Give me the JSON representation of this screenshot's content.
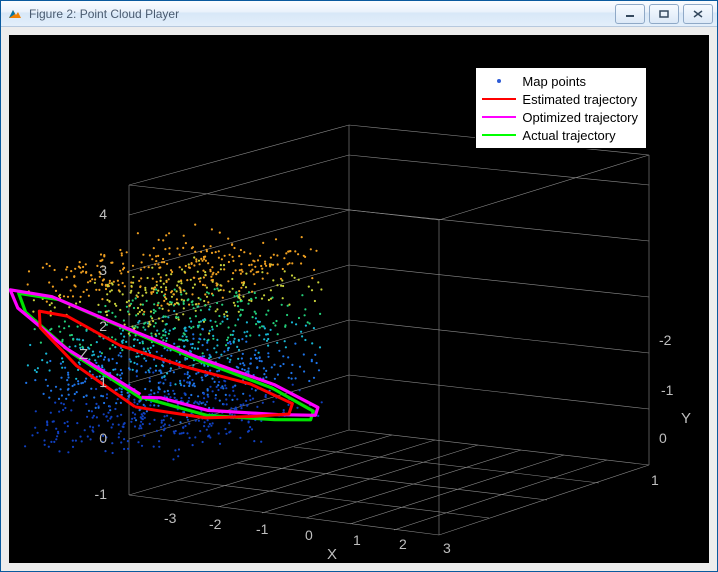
{
  "window": {
    "title": "Figure 2: Point Cloud Player",
    "controls": {
      "minimize": "minimize",
      "maximize": "maximize",
      "close": "close"
    }
  },
  "axes": {
    "xlabel": "X",
    "ylabel": "Y",
    "zlabel": "Z",
    "xticks": [
      "-3",
      "-2",
      "-1",
      "0",
      "1",
      "2",
      "3"
    ],
    "yticks": [
      "-2",
      "-1",
      "0",
      "1"
    ],
    "zticks": [
      "-1",
      "0",
      "1",
      "2",
      "3",
      "4"
    ]
  },
  "legend": {
    "items": [
      {
        "label": "Map points",
        "kind": "dot",
        "color": "#2d5bd6"
      },
      {
        "label": "Estimated trajectory",
        "kind": "line",
        "color": "#ff0000"
      },
      {
        "label": "Optimized trajectory",
        "kind": "line",
        "color": "#ff00ff"
      },
      {
        "label": "Actual trajectory",
        "kind": "line",
        "color": "#00ff00"
      }
    ]
  },
  "chart_data": {
    "type": "scatter",
    "title": "",
    "xlabel": "X",
    "ylabel": "Y",
    "zlabel": "Z",
    "xlim": [
      -3.5,
      3.5
    ],
    "ylim": [
      -2.5,
      1.5
    ],
    "zlim": [
      -1,
      4.5
    ],
    "map_points": {
      "description": "Dense 3D point cloud colored by height (z); exact coordinates not recoverable from raster. Roughly 2000+ points clustered in x∈[-2,2], y∈[-2,1], z∈[1,4], color ramp blue→cyan→green→yellow→orange with increasing z.",
      "approx_count": 2500
    },
    "series": [
      {
        "name": "Estimated trajectory",
        "color": "#ff0000",
        "xyz_approx": [
          [
            -1.5,
            0.0,
            1.2
          ],
          [
            -2.2,
            -0.5,
            2.0
          ],
          [
            -2.4,
            -1.0,
            2.8
          ],
          [
            -1.8,
            -1.5,
            3.3
          ],
          [
            -0.8,
            -1.8,
            3.4
          ],
          [
            0.4,
            -1.8,
            3.0
          ],
          [
            1.4,
            -1.4,
            2.6
          ],
          [
            2.1,
            -0.8,
            2.2
          ],
          [
            2.3,
            -0.2,
            1.7
          ],
          [
            1.6,
            0.3,
            1.3
          ],
          [
            0.6,
            0.5,
            1.1
          ],
          [
            -0.4,
            0.4,
            1.0
          ],
          [
            -1.2,
            0.2,
            1.1
          ]
        ]
      },
      {
        "name": "Optimized trajectory",
        "color": "#ff00ff",
        "xyz_approx": [
          [
            -1.6,
            0.2,
            1.3
          ],
          [
            -2.5,
            -0.4,
            2.2
          ],
          [
            -2.7,
            -1.1,
            3.1
          ],
          [
            -2.0,
            -1.8,
            3.7
          ],
          [
            -0.7,
            -2.1,
            3.8
          ],
          [
            0.7,
            -2.0,
            3.4
          ],
          [
            1.8,
            -1.5,
            2.8
          ],
          [
            2.6,
            -0.8,
            2.2
          ],
          [
            2.7,
            -0.1,
            1.6
          ],
          [
            1.9,
            0.5,
            1.2
          ],
          [
            0.7,
            0.8,
            1.0
          ],
          [
            -0.6,
            0.6,
            1.0
          ],
          [
            -1.4,
            0.4,
            1.2
          ]
        ]
      },
      {
        "name": "Actual trajectory",
        "color": "#00ff00",
        "xyz_approx": [
          [
            -1.6,
            0.2,
            1.3
          ],
          [
            -2.5,
            -0.4,
            2.2
          ],
          [
            -2.7,
            -1.1,
            3.1
          ],
          [
            -2.0,
            -1.8,
            3.7
          ],
          [
            -0.7,
            -2.1,
            3.8
          ],
          [
            0.7,
            -2.0,
            3.4
          ],
          [
            1.8,
            -1.5,
            2.8
          ],
          [
            2.6,
            -0.8,
            2.2
          ],
          [
            2.7,
            -0.1,
            1.6
          ],
          [
            1.9,
            0.5,
            1.2
          ],
          [
            0.7,
            0.8,
            1.0
          ],
          [
            -0.6,
            0.6,
            1.0
          ],
          [
            -1.4,
            0.4,
            1.2
          ]
        ]
      }
    ]
  }
}
